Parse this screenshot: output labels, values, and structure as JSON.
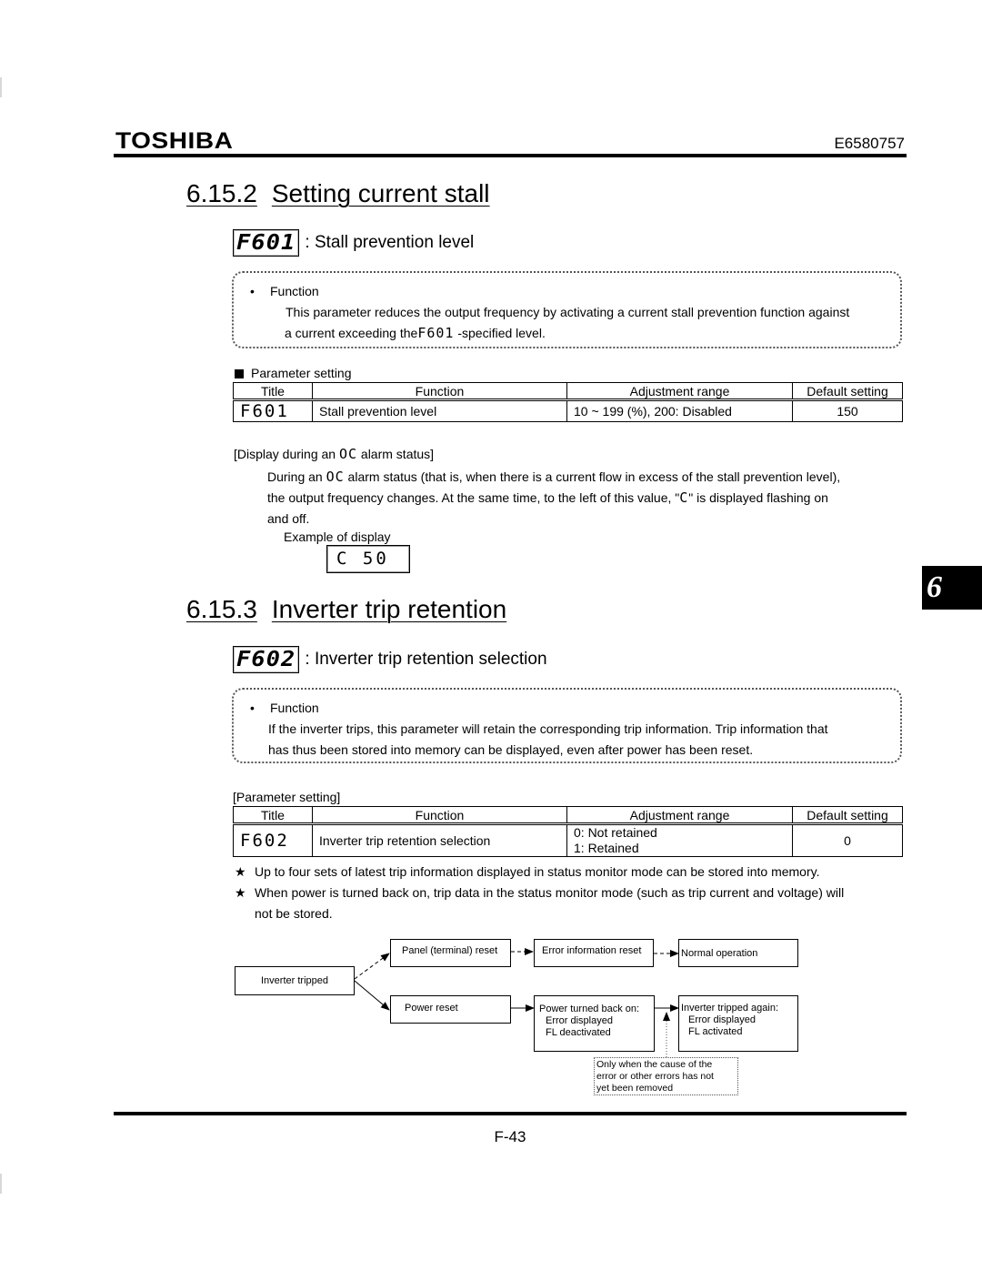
{
  "header": {
    "brand": "TOSHIBA",
    "doc_number": "E6580757"
  },
  "section_6_15_2": {
    "number": "6.15.2",
    "title": "Setting current stall",
    "param_code": "F601",
    "param_name": ": Stall prevention level",
    "function_box": {
      "bullet_label": "Function",
      "line1": "This parameter reduces the output frequency by activating a current stall prevention function against",
      "line2_prefix": "a current exceeding the",
      "line2_code": "F601",
      "line2_suffix": "-specified level."
    },
    "param_setting": {
      "label": "Parameter setting",
      "columns": [
        "Title",
        "Function",
        "Adjustment range",
        "Default setting"
      ],
      "rows": [
        {
          "title": "F601",
          "function": "Stall prevention level",
          "range": "10 ~ 199 (%), 200: Disabled",
          "default": "150"
        }
      ]
    },
    "alarm_display": {
      "heading_prefix": "[Display during an",
      "heading_code": "OC",
      "heading_suffix": "alarm status]",
      "para_l1_prefix": "During an",
      "para_l1_code": "OC",
      "para_l1_suffix": "alarm status (that is, when there is a current flow in excess of the stall prevention level),",
      "para_l2_prefix": "the output frequency changes. At the same time, to the left of this value, \"",
      "para_l2_code": "C",
      "para_l2_suffix": "\" is displayed flashing on",
      "para_l3": "and off.",
      "example_label": "Example of display",
      "example_value": "C 50"
    }
  },
  "section_6_15_3": {
    "number": "6.15.3",
    "title": "Inverter trip retention",
    "param_code": "F602",
    "param_name": ": Inverter trip retention selection",
    "function_box": {
      "bullet_label": "Function",
      "line1": "If the inverter trips, this parameter will retain the corresponding trip information.  Trip information that",
      "line2": "has thus been stored into memory can be displayed, even after power has been reset."
    },
    "param_setting": {
      "label": "[Parameter setting]",
      "columns": [
        "Title",
        "Function",
        "Adjustment range",
        "Default setting"
      ],
      "rows": [
        {
          "title": "F602",
          "function": "Inverter trip retention selection",
          "range_line1": "0: Not retained",
          "range_line2": "1: Retained",
          "default": "0"
        }
      ]
    },
    "notes": [
      "Up to four sets of latest trip information displayed in status monitor mode can be stored into memory.",
      "When power is turned back on, trip data in the status monitor mode (such as trip current and voltage) will",
      "not be stored."
    ],
    "star_glyph": "★",
    "flowchart": {
      "inverter_tripped": "Inverter tripped",
      "panel_reset": "Panel (terminal) reset",
      "error_info_reset": "Error information reset",
      "normal_operation": "Normal operation",
      "power_reset": "Power reset",
      "power_on_title": "Power turned back on:",
      "power_on_l1": "Error displayed",
      "power_on_l2": "FL deactivated",
      "tripped_again_title": "Inverter tripped again:",
      "tripped_again_l1": "Error displayed",
      "tripped_again_l2": "FL activated",
      "note_l1": "Only when the cause of the",
      "note_l2": "error or other errors has not",
      "note_l3": "yet been removed"
    }
  },
  "chapter_tab": "6",
  "footer": {
    "page_number": "F-43"
  }
}
